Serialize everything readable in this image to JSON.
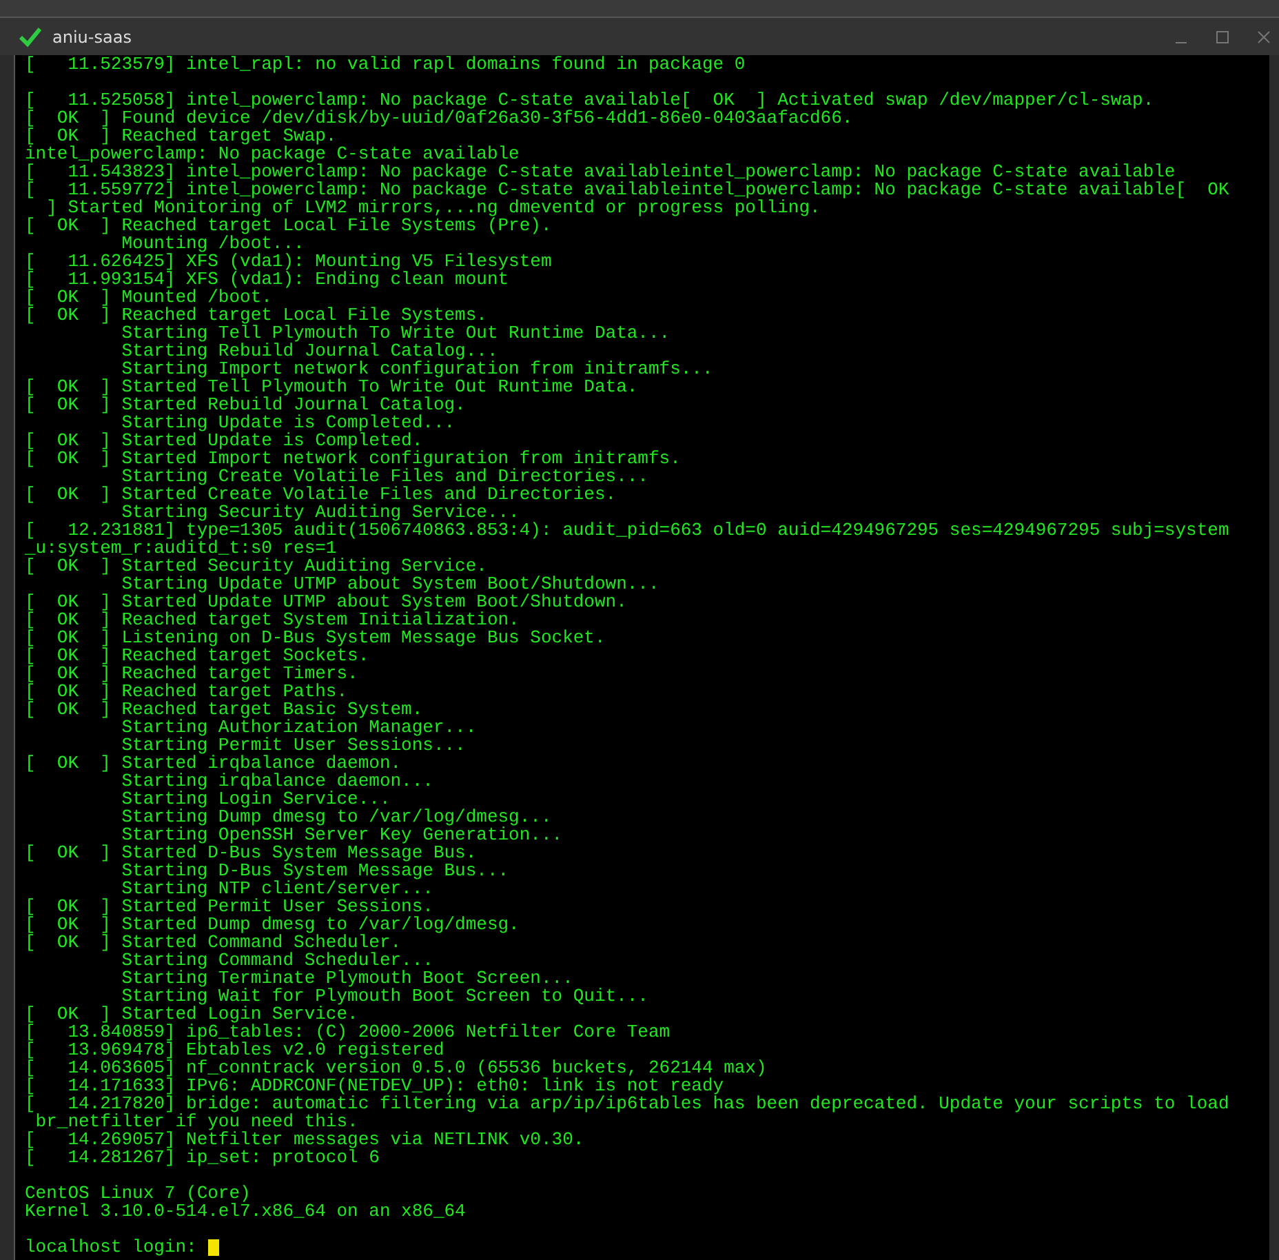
{
  "window": {
    "title": "aniu-saas"
  },
  "terminal": {
    "lines": [
      {
        "kind": "text",
        "text": "[   11.523579] intel_rapl: no valid rapl domains found in package 0"
      },
      {
        "kind": "blank"
      },
      {
        "kind": "text",
        "text": "[   11.525058] intel_powerclamp: No package C-state available[  OK  ] Activated swap /dev/mapper/cl-swap."
      },
      {
        "kind": "text",
        "text": "[  OK  ] Found device /dev/disk/by-uuid/0af26a30-3f56-4dd1-86e0-0403aafacd66."
      },
      {
        "kind": "text",
        "text": "[  OK  ] Reached target Swap."
      },
      {
        "kind": "text",
        "text": "intel_powerclamp: No package C-state available"
      },
      {
        "kind": "text",
        "text": "[   11.543823] intel_powerclamp: No package C-state availableintel_powerclamp: No package C-state available"
      },
      {
        "kind": "text",
        "text": "[   11.559772] intel_powerclamp: No package C-state availableintel_powerclamp: No package C-state available[  OK"
      },
      {
        "kind": "text",
        "text": "  ] Started Monitoring of LVM2 mirrors,...ng dmeventd or progress polling."
      },
      {
        "kind": "text",
        "text": "[  OK  ] Reached target Local File Systems (Pre)."
      },
      {
        "kind": "text",
        "text": "         Mounting /boot..."
      },
      {
        "kind": "text",
        "text": "[   11.626425] XFS (vda1): Mounting V5 Filesystem"
      },
      {
        "kind": "text",
        "text": "[   11.993154] XFS (vda1): Ending clean mount"
      },
      {
        "kind": "text",
        "text": "[  OK  ] Mounted /boot."
      },
      {
        "kind": "text",
        "text": "[  OK  ] Reached target Local File Systems."
      },
      {
        "kind": "text",
        "text": "         Starting Tell Plymouth To Write Out Runtime Data..."
      },
      {
        "kind": "text",
        "text": "         Starting Rebuild Journal Catalog..."
      },
      {
        "kind": "text",
        "text": "         Starting Import network configuration from initramfs..."
      },
      {
        "kind": "text",
        "text": "[  OK  ] Started Tell Plymouth To Write Out Runtime Data."
      },
      {
        "kind": "text",
        "text": "[  OK  ] Started Rebuild Journal Catalog."
      },
      {
        "kind": "text",
        "text": "         Starting Update is Completed..."
      },
      {
        "kind": "text",
        "text": "[  OK  ] Started Update is Completed."
      },
      {
        "kind": "text",
        "text": "[  OK  ] Started Import network configuration from initramfs."
      },
      {
        "kind": "text",
        "text": "         Starting Create Volatile Files and Directories..."
      },
      {
        "kind": "text",
        "text": "[  OK  ] Started Create Volatile Files and Directories."
      },
      {
        "kind": "text",
        "text": "         Starting Security Auditing Service..."
      },
      {
        "kind": "text",
        "text": "[   12.231881] type=1305 audit(1506740863.853:4): audit_pid=663 old=0 auid=4294967295 ses=4294967295 subj=system"
      },
      {
        "kind": "text",
        "text": "_u:system_r:auditd_t:s0 res=1"
      },
      {
        "kind": "text",
        "text": "[  OK  ] Started Security Auditing Service."
      },
      {
        "kind": "text",
        "text": "         Starting Update UTMP about System Boot/Shutdown..."
      },
      {
        "kind": "text",
        "text": "[  OK  ] Started Update UTMP about System Boot/Shutdown."
      },
      {
        "kind": "text",
        "text": "[  OK  ] Reached target System Initialization."
      },
      {
        "kind": "text",
        "text": "[  OK  ] Listening on D-Bus System Message Bus Socket."
      },
      {
        "kind": "text",
        "text": "[  OK  ] Reached target Sockets."
      },
      {
        "kind": "text",
        "text": "[  OK  ] Reached target Timers."
      },
      {
        "kind": "text",
        "text": "[  OK  ] Reached target Paths."
      },
      {
        "kind": "text",
        "text": "[  OK  ] Reached target Basic System."
      },
      {
        "kind": "text",
        "text": "         Starting Authorization Manager..."
      },
      {
        "kind": "text",
        "text": "         Starting Permit User Sessions..."
      },
      {
        "kind": "text",
        "text": "[  OK  ] Started irqbalance daemon."
      },
      {
        "kind": "text",
        "text": "         Starting irqbalance daemon..."
      },
      {
        "kind": "text",
        "text": "         Starting Login Service..."
      },
      {
        "kind": "text",
        "text": "         Starting Dump dmesg to /var/log/dmesg..."
      },
      {
        "kind": "text",
        "text": "         Starting OpenSSH Server Key Generation..."
      },
      {
        "kind": "text",
        "text": "[  OK  ] Started D-Bus System Message Bus."
      },
      {
        "kind": "text",
        "text": "         Starting D-Bus System Message Bus..."
      },
      {
        "kind": "text",
        "text": "         Starting NTP client/server..."
      },
      {
        "kind": "text",
        "text": "[  OK  ] Started Permit User Sessions."
      },
      {
        "kind": "text",
        "text": "[  OK  ] Started Dump dmesg to /var/log/dmesg."
      },
      {
        "kind": "text",
        "text": "[  OK  ] Started Command Scheduler."
      },
      {
        "kind": "text",
        "text": "         Starting Command Scheduler..."
      },
      {
        "kind": "text",
        "text": "         Starting Terminate Plymouth Boot Screen..."
      },
      {
        "kind": "text",
        "text": "         Starting Wait for Plymouth Boot Screen to Quit..."
      },
      {
        "kind": "text",
        "text": "[  OK  ] Started Login Service."
      },
      {
        "kind": "text",
        "text": "[   13.840859] ip6_tables: (C) 2000-2006 Netfilter Core Team"
      },
      {
        "kind": "text",
        "text": "[   13.969478] Ebtables v2.0 registered"
      },
      {
        "kind": "text",
        "text": "[   14.063605] nf_conntrack version 0.5.0 (65536 buckets, 262144 max)"
      },
      {
        "kind": "text",
        "text": "[   14.171633] IPv6: ADDRCONF(NETDEV_UP): eth0: link is not ready"
      },
      {
        "kind": "text",
        "text": "[   14.217820] bridge: automatic filtering via arp/ip/ip6tables has been deprecated. Update your scripts to load"
      },
      {
        "kind": "text",
        "text": " br_netfilter if you need this."
      },
      {
        "kind": "text",
        "text": "[   14.269057] Netfilter messages via NETLINK v0.30."
      },
      {
        "kind": "text",
        "text": "[   14.281267] ip_set: protocol 6"
      },
      {
        "kind": "blank"
      },
      {
        "kind": "text",
        "text": "CentOS Linux 7 (Core)"
      },
      {
        "kind": "text",
        "text": "Kernel 3.10.0-514.el7.x86_64 on an x86_64"
      },
      {
        "kind": "blank"
      },
      {
        "kind": "prompt",
        "text": "localhost login: "
      }
    ]
  }
}
